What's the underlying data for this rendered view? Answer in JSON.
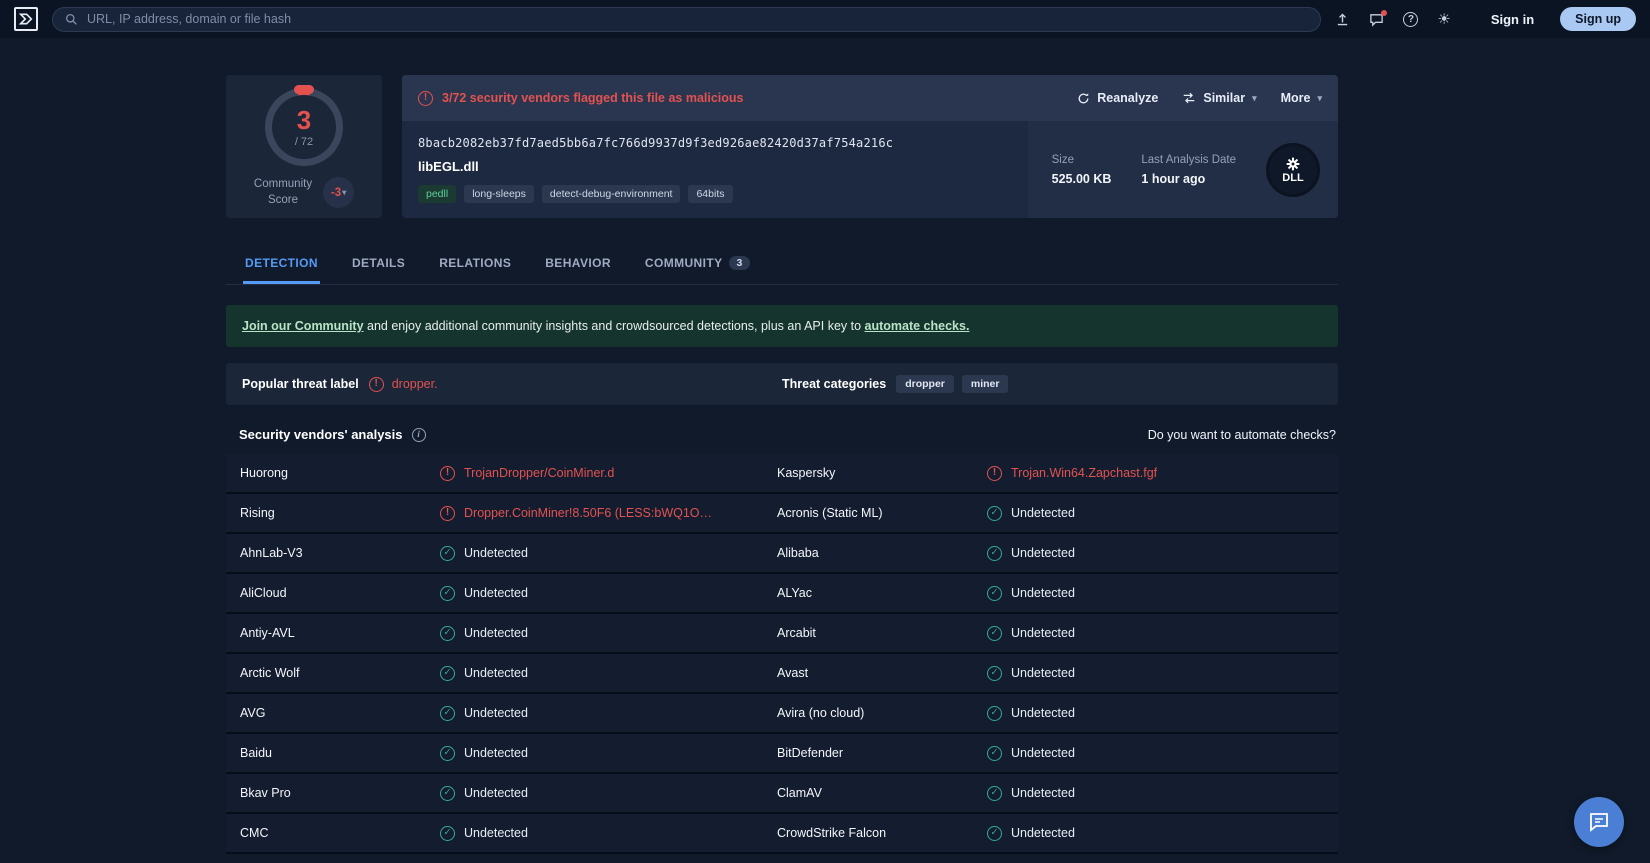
{
  "colors": {
    "accent_blue": "#569af5",
    "malicious_red": "#e3524f",
    "undetected_green": "#34ac92",
    "banner_green": "#16342e",
    "signup_blue": "#a9c9f2"
  },
  "topbar": {
    "search_placeholder": "URL, IP address, domain or file hash",
    "signin": "Sign in",
    "signup": "Sign up"
  },
  "score": {
    "value": "3",
    "total": "/ 72",
    "community_label_1": "Community",
    "community_label_2": "Score",
    "community_score": "-3"
  },
  "file_card": {
    "flag_message": "3/72 security vendors flagged this file as malicious",
    "actions": {
      "reanalyze": "Reanalyze",
      "similar": "Similar",
      "more": "More"
    },
    "hash": "8bacb2082eb37fd7aed5bb6a7fc766d9937d9f3ed926ae82420d37af754a216c",
    "filename": "libEGL.dll",
    "tags": [
      {
        "label": "pedll",
        "variant": "green"
      },
      {
        "label": "long-sleeps",
        "variant": "default"
      },
      {
        "label": "detect-debug-environment",
        "variant": "default"
      },
      {
        "label": "64bits",
        "variant": "default"
      }
    ],
    "size_label": "Size",
    "size_value": "525.00 KB",
    "last_analysis_label": "Last Analysis Date",
    "last_analysis_value": "1 hour ago",
    "file_type": "DLL"
  },
  "tabs": [
    {
      "label": "DETECTION",
      "active": true
    },
    {
      "label": "DETAILS",
      "active": false
    },
    {
      "label": "RELATIONS",
      "active": false
    },
    {
      "label": "BEHAVIOR",
      "active": false
    },
    {
      "label": "COMMUNITY",
      "active": false,
      "badge": "3"
    }
  ],
  "banner": {
    "link1": "Join our Community",
    "middle": " and enjoy additional community insights and crowdsourced detections, plus an API key to ",
    "link2": "automate checks."
  },
  "threat": {
    "label": "Popular threat label",
    "value": "dropper.",
    "categories_label": "Threat categories",
    "categories": [
      "dropper",
      "miner"
    ]
  },
  "analysis": {
    "title": "Security vendors' analysis",
    "automate_question": "Do you want to automate checks?",
    "rows": [
      [
        {
          "vendor": "Huorong",
          "result": "TrojanDropper/CoinMiner.d",
          "status": "malicious"
        },
        {
          "vendor": "Kaspersky",
          "result": "Trojan.Win64.Zapchast.fgf",
          "status": "malicious"
        }
      ],
      [
        {
          "vendor": "Rising",
          "result": "Dropper.CoinMiner!8.50F6 (LESS:bWQ1O…",
          "status": "malicious"
        },
        {
          "vendor": "Acronis (Static ML)",
          "result": "Undetected",
          "status": "undetected"
        }
      ],
      [
        {
          "vendor": "AhnLab-V3",
          "result": "Undetected",
          "status": "undetected"
        },
        {
          "vendor": "Alibaba",
          "result": "Undetected",
          "status": "undetected"
        }
      ],
      [
        {
          "vendor": "AliCloud",
          "result": "Undetected",
          "status": "undetected"
        },
        {
          "vendor": "ALYac",
          "result": "Undetected",
          "status": "undetected"
        }
      ],
      [
        {
          "vendor": "Antiy-AVL",
          "result": "Undetected",
          "status": "undetected"
        },
        {
          "vendor": "Arcabit",
          "result": "Undetected",
          "status": "undetected"
        }
      ],
      [
        {
          "vendor": "Arctic Wolf",
          "result": "Undetected",
          "status": "undetected"
        },
        {
          "vendor": "Avast",
          "result": "Undetected",
          "status": "undetected"
        }
      ],
      [
        {
          "vendor": "AVG",
          "result": "Undetected",
          "status": "undetected"
        },
        {
          "vendor": "Avira (no cloud)",
          "result": "Undetected",
          "status": "undetected"
        }
      ],
      [
        {
          "vendor": "Baidu",
          "result": "Undetected",
          "status": "undetected"
        },
        {
          "vendor": "BitDefender",
          "result": "Undetected",
          "status": "undetected"
        }
      ],
      [
        {
          "vendor": "Bkav Pro",
          "result": "Undetected",
          "status": "undetected"
        },
        {
          "vendor": "ClamAV",
          "result": "Undetected",
          "status": "undetected"
        }
      ],
      [
        {
          "vendor": "CMC",
          "result": "Undetected",
          "status": "undetected"
        },
        {
          "vendor": "CrowdStrike Falcon",
          "result": "Undetected",
          "status": "undetected"
        }
      ]
    ]
  }
}
